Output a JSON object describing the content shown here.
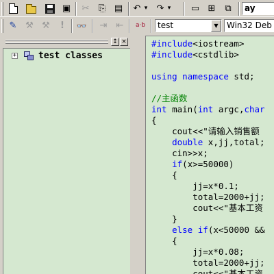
{
  "toolbar_top": {
    "buttons": [
      {
        "name": "new-file-icon",
        "glyph": ""
      },
      {
        "name": "open-folder-icon",
        "glyph": ""
      },
      {
        "name": "save-icon",
        "glyph": ""
      },
      {
        "name": "save-all-icon",
        "glyph": "▣"
      },
      {
        "name": "cut-icon",
        "glyph": "✂"
      },
      {
        "name": "copy-icon",
        "glyph": "⎘"
      },
      {
        "name": "paste-icon",
        "glyph": "▤"
      },
      {
        "name": "undo-icon",
        "glyph": "↶"
      },
      {
        "name": "undo-dropdown-icon",
        "glyph": "▾"
      },
      {
        "name": "redo-icon",
        "glyph": "↷"
      },
      {
        "name": "redo-dropdown-icon",
        "glyph": "▾"
      },
      {
        "name": "workspace-icon",
        "glyph": "▭"
      },
      {
        "name": "output-window-icon",
        "glyph": "⊞"
      },
      {
        "name": "window-list-icon",
        "glyph": "⧉"
      }
    ],
    "find_text": "ay"
  },
  "toolbar_bottom": {
    "buttons": [
      {
        "name": "compile-icon",
        "glyph": "✎"
      },
      {
        "name": "build-icon",
        "glyph": "⚒"
      },
      {
        "name": "stop-build-icon",
        "glyph": "⚒"
      },
      {
        "name": "execute-icon",
        "glyph": "!"
      },
      {
        "name": "find-icon",
        "glyph": "👓"
      },
      {
        "name": "indent-icon",
        "glyph": "⇥"
      },
      {
        "name": "outdent-icon",
        "glyph": "⇤"
      },
      {
        "name": "replace-icon",
        "glyph": "a·b"
      }
    ],
    "project_select": "test",
    "config_select": "Win32 Deb"
  },
  "workspace": {
    "tree_root_label": "test classes",
    "expander": "+",
    "pin_button": "↕",
    "close_button": "×"
  },
  "editor": {
    "lines": [
      {
        "parts": [
          {
            "t": "#include",
            "c": "kw"
          },
          {
            "t": "<iostream>",
            "c": ""
          }
        ]
      },
      {
        "parts": [
          {
            "t": "#include",
            "c": "kw"
          },
          {
            "t": "<cstdlib>",
            "c": ""
          }
        ]
      },
      {
        "parts": []
      },
      {
        "parts": [
          {
            "t": "using",
            "c": "kw"
          },
          {
            "t": " ",
            "c": ""
          },
          {
            "t": "namespace",
            "c": "kw"
          },
          {
            "t": " std;",
            "c": ""
          }
        ]
      },
      {
        "parts": []
      },
      {
        "parts": [
          {
            "t": "//主函数",
            "c": "cm"
          }
        ]
      },
      {
        "parts": [
          {
            "t": "int",
            "c": "kw"
          },
          {
            "t": " main(",
            "c": ""
          },
          {
            "t": "int",
            "c": "kw"
          },
          {
            "t": " argc,",
            "c": ""
          },
          {
            "t": "char",
            "c": "kw"
          }
        ]
      },
      {
        "parts": [
          {
            "t": "{",
            "c": ""
          }
        ]
      },
      {
        "parts": [
          {
            "t": "    cout<<\"请输入销售额",
            "c": ""
          }
        ]
      },
      {
        "parts": [
          {
            "t": "    ",
            "c": ""
          },
          {
            "t": "double",
            "c": "kw"
          },
          {
            "t": " x,jj,total;",
            "c": ""
          }
        ]
      },
      {
        "parts": [
          {
            "t": "    cin>>x;",
            "c": ""
          }
        ]
      },
      {
        "parts": [
          {
            "t": "    ",
            "c": ""
          },
          {
            "t": "if",
            "c": "kw"
          },
          {
            "t": "(x>=50000)",
            "c": ""
          }
        ]
      },
      {
        "parts": [
          {
            "t": "    {",
            "c": ""
          }
        ]
      },
      {
        "parts": [
          {
            "t": "        jj=x*0.1;",
            "c": ""
          }
        ]
      },
      {
        "parts": [
          {
            "t": "        total=2000+jj;",
            "c": ""
          }
        ]
      },
      {
        "parts": [
          {
            "t": "        cout<<\"基本工资",
            "c": ""
          }
        ]
      },
      {
        "parts": [
          {
            "t": "    }",
            "c": ""
          }
        ]
      },
      {
        "parts": [
          {
            "t": "    ",
            "c": ""
          },
          {
            "t": "else",
            "c": "kw"
          },
          {
            "t": " ",
            "c": ""
          },
          {
            "t": "if",
            "c": "kw"
          },
          {
            "t": "(x<50000 &&",
            "c": ""
          }
        ]
      },
      {
        "parts": [
          {
            "t": "    {",
            "c": ""
          }
        ]
      },
      {
        "parts": [
          {
            "t": "        jj=x*0.08;",
            "c": ""
          }
        ]
      },
      {
        "parts": [
          {
            "t": "        total=2000+jj;",
            "c": ""
          }
        ]
      },
      {
        "parts": [
          {
            "t": "        cout<<\"基本工资",
            "c": ""
          }
        ]
      }
    ]
  },
  "colors": {
    "keyword": "#0000ff",
    "comment": "#008000",
    "editor_bg": "#d5e8d0",
    "chrome_bg": "#d4d0c8"
  }
}
